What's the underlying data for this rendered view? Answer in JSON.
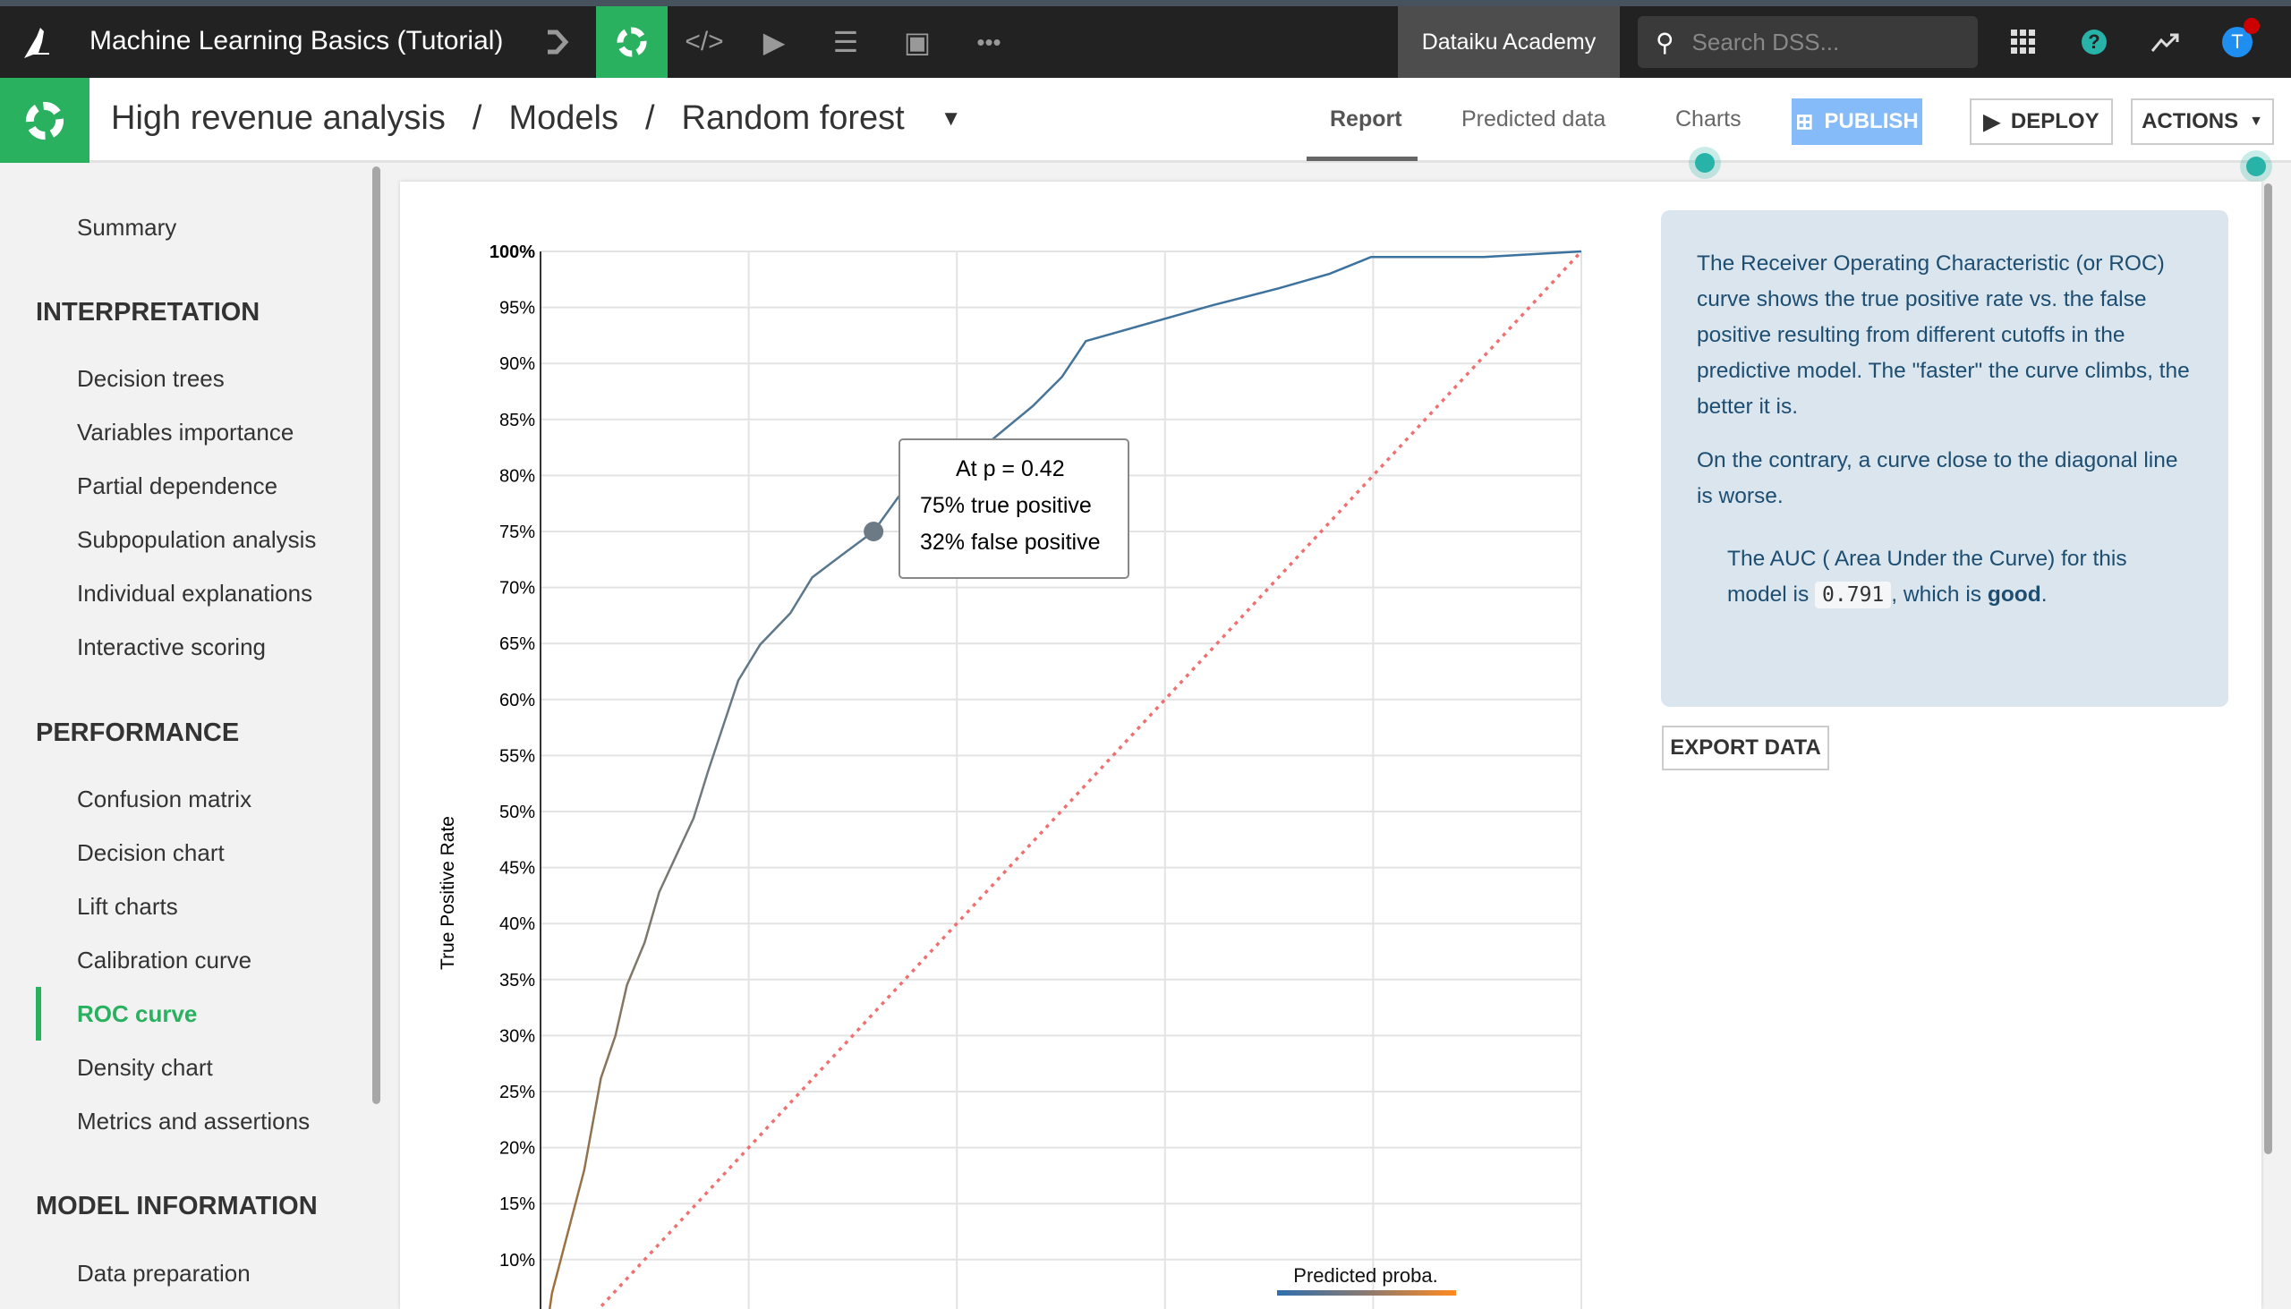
{
  "topbar": {
    "app_title": "Machine Learning Basics (Tutorial)",
    "academy": "Dataiku Academy",
    "search_placeholder": "Search DSS...",
    "avatar_initial": "T"
  },
  "breadcrumb": {
    "items": [
      "High revenue analysis",
      "Models",
      "Random forest"
    ],
    "separator": "/"
  },
  "tabs": [
    {
      "label": "Report",
      "active": true
    },
    {
      "label": "Predicted data"
    },
    {
      "label": "Charts"
    }
  ],
  "buttons": {
    "publish": "PUBLISH",
    "deploy": "DEPLOY",
    "actions": "ACTIONS",
    "export": "EXPORT DATA"
  },
  "sidebar": {
    "summary": "Summary",
    "sections": [
      {
        "title": "INTERPRETATION",
        "items": [
          "Decision trees",
          "Variables importance",
          "Partial dependence",
          "Subpopulation analysis",
          "Individual explanations",
          "Interactive scoring"
        ]
      },
      {
        "title": "PERFORMANCE",
        "items": [
          "Confusion matrix",
          "Decision chart",
          "Lift charts",
          "Calibration curve",
          "ROC curve",
          "Density chart",
          "Metrics and assertions"
        ]
      },
      {
        "title": "MODEL INFORMATION",
        "items": [
          "Data preparation"
        ]
      }
    ],
    "active": "ROC curve"
  },
  "info": {
    "p1": "The Receiver Operating Characteristic (or ROC) curve shows the true positive rate vs. the false positive resulting from different cutoffs in the predictive model. The \"faster\" the curve climbs, the better it is.",
    "p2": "On the contrary, a curve close to the diagonal line is worse.",
    "auc_pre": "The AUC ( Area Under the Curve) for this model is",
    "auc_value": "0.791",
    "auc_mid": ", which is",
    "auc_rating": "good",
    "auc_end": "."
  },
  "tooltip": {
    "line1": "At p = 0.42",
    "line2": "75% true positive",
    "line3": "32% false positive"
  },
  "colors": {
    "accent": "#2ab160",
    "publish": "#85bbf9",
    "diagonal": "#f07070",
    "curve_high": "#3a72a0",
    "curve_low": "#a0703a"
  },
  "chart_data": {
    "type": "line",
    "ylabel": "True Positive Rate",
    "legend_label": "Predicted proba.",
    "yticks": [
      "10%",
      "15%",
      "20%",
      "25%",
      "30%",
      "35%",
      "40%",
      "45%",
      "50%",
      "55%",
      "60%",
      "65%",
      "70%",
      "75%",
      "80%",
      "85%",
      "90%",
      "95%",
      "100%"
    ],
    "xlim": [
      0,
      1
    ],
    "ylim_visible": [
      0.07,
      1
    ],
    "grid": true,
    "series": [
      {
        "x": [
          0,
          0.011,
          0.042,
          0.058,
          0.072,
          0.083,
          0.1,
          0.114,
          0.147,
          0.161,
          0.19,
          0.211,
          0.24,
          0.261,
          0.291,
          0.32,
          0.344,
          0.379,
          0.43,
          0.473,
          0.501,
          0.524,
          0.646,
          0.709,
          0.758,
          0.798,
          0.906,
          1
        ],
        "y": [
          0,
          0.07,
          0.18,
          0.262,
          0.3,
          0.345,
          0.383,
          0.428,
          0.494,
          0.536,
          0.617,
          0.649,
          0.677,
          0.709,
          0.73,
          0.75,
          0.781,
          0.804,
          0.829,
          0.862,
          0.888,
          0.92,
          0.952,
          0.967,
          0.98,
          0.995,
          0.995,
          1
        ]
      }
    ],
    "diagonal": {
      "x": [
        0,
        1
      ],
      "y": [
        0,
        1
      ]
    },
    "highlight": {
      "fpr": 0.32,
      "tpr": 0.75,
      "threshold": 0.42
    }
  }
}
